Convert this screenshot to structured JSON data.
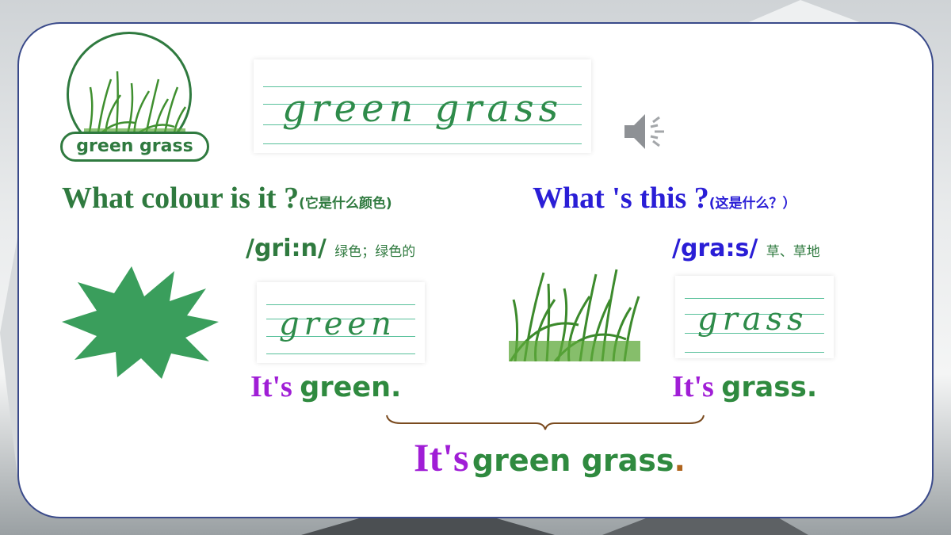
{
  "badge": {
    "label": "green grass"
  },
  "title_card": {
    "word": "green grass"
  },
  "question_colour": {
    "text": "What colour is it ?",
    "note": "(它是什么颜色)"
  },
  "question_this": {
    "text": "What 's this ?",
    "note": "(这是什么？）"
  },
  "phonetic_green": {
    "ipa": "/gri:n/",
    "meaning": "绿色；绿色的"
  },
  "phonetic_grass": {
    "ipa": "/gra:s/",
    "meaning": "草、草地"
  },
  "card_green": {
    "word": "green"
  },
  "card_grass": {
    "word": "grass"
  },
  "answer_green": {
    "its": "It's",
    "word": "green."
  },
  "answer_grass": {
    "its": "It's",
    "word": "grass."
  },
  "summary": {
    "its": "It's",
    "words": "green grass",
    "period": "."
  },
  "colors": {
    "green": "#2f8a3f",
    "blue": "#2a1ed6",
    "purple": "#a01ed6",
    "star": "#3a9e5c"
  },
  "icons": [
    "speaker-icon",
    "grass-image",
    "green-star-shape",
    "brace-icon"
  ]
}
